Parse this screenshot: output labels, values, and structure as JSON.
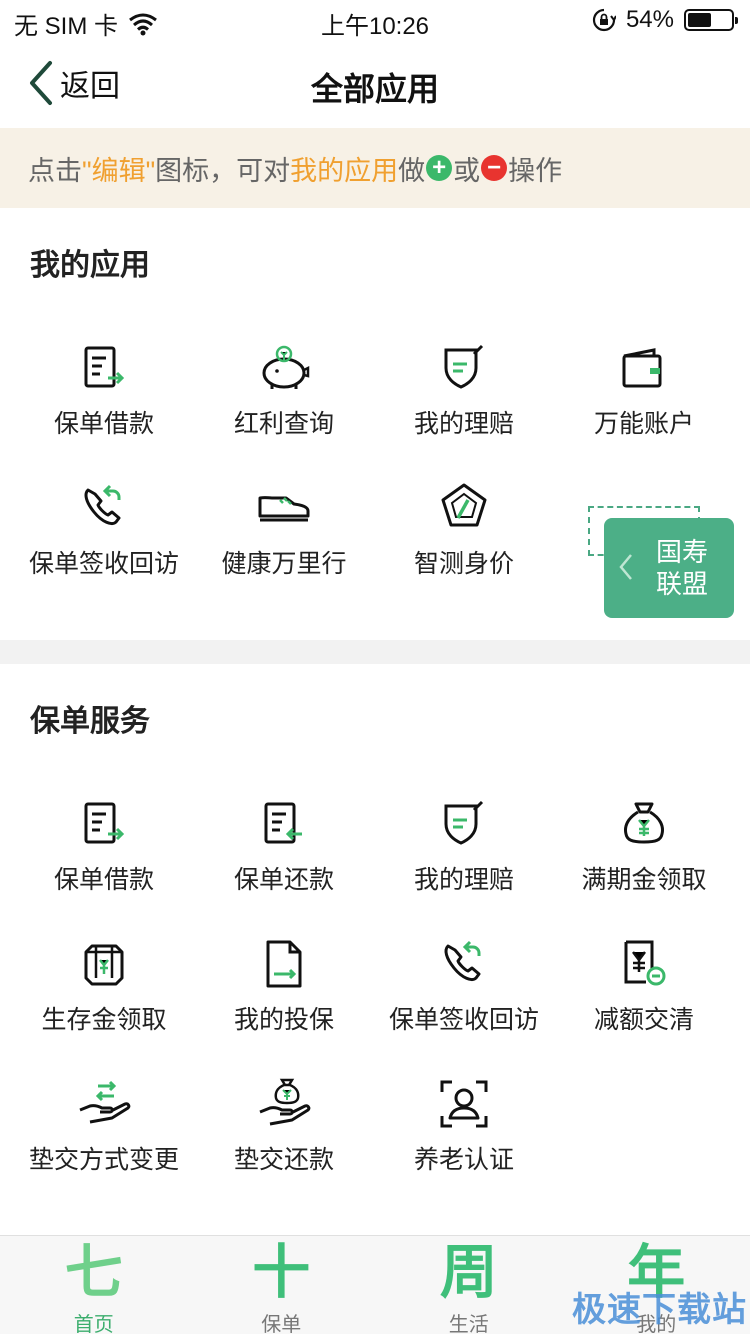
{
  "status_bar": {
    "carrier": "无 SIM 卡",
    "time": "上午10:26",
    "battery_percent": "54%",
    "battery_level": 0.54,
    "icons": [
      "wifi-icon",
      "rotation-lock-icon",
      "battery-icon"
    ]
  },
  "nav": {
    "back_label": "返回",
    "title": "全部应用"
  },
  "tip": {
    "prefix": "点击",
    "edit_word": "\"编辑\"",
    "middle": "图标，可对",
    "my_apps": "我的应用",
    "do_word": "做",
    "or_word": "或",
    "suffix": "操作",
    "plus_symbol": "+",
    "minus_symbol": "−"
  },
  "my_apps": {
    "title": "我的应用",
    "items": [
      {
        "label": "保单借款",
        "icon": "document-export-icon"
      },
      {
        "label": "红利查询",
        "icon": "piggy-bank-icon"
      },
      {
        "label": "我的理赔",
        "icon": "shield-check-icon"
      },
      {
        "label": "万能账户",
        "icon": "wallet-icon"
      },
      {
        "label": "保单签收回访",
        "icon": "phone-callback-icon"
      },
      {
        "label": "健康万里行",
        "icon": "sneaker-icon"
      },
      {
        "label": "智测身价",
        "icon": "pentagon-chart-icon"
      }
    ]
  },
  "policy_services": {
    "title": "保单服务",
    "items": [
      {
        "label": "保单借款",
        "icon": "document-export-icon"
      },
      {
        "label": "保单还款",
        "icon": "document-import-icon"
      },
      {
        "label": "我的理赔",
        "icon": "shield-check-icon"
      },
      {
        "label": "满期金领取",
        "icon": "money-bag-icon"
      },
      {
        "label": "生存金领取",
        "icon": "money-box-icon"
      },
      {
        "label": "我的投保",
        "icon": "file-sign-icon"
      },
      {
        "label": "保单签收回访",
        "icon": "phone-callback-icon"
      },
      {
        "label": "减额交清",
        "icon": "yuan-minus-icon"
      },
      {
        "label": "垫交方式变更",
        "icon": "hand-exchange-icon"
      },
      {
        "label": "垫交还款",
        "icon": "hand-money-icon"
      },
      {
        "label": "养老认证",
        "icon": "face-scan-icon"
      }
    ]
  },
  "float_tab": {
    "line1": "国寿",
    "line2": "联盟"
  },
  "tab_bar": {
    "tabs": [
      {
        "glyph": "七",
        "label": "首页",
        "active": true
      },
      {
        "glyph": "十",
        "label": "保单",
        "active": false
      },
      {
        "glyph": "周",
        "label": "生活",
        "active": false
      },
      {
        "glyph": "年",
        "label": "我的",
        "active": false
      }
    ]
  },
  "watermark": "极速下载站",
  "colors": {
    "accent_green": "#3cae6e",
    "highlight_orange": "#f0a030",
    "tip_bg": "#f7f1e6",
    "float_tab_bg": "#4caf87"
  }
}
